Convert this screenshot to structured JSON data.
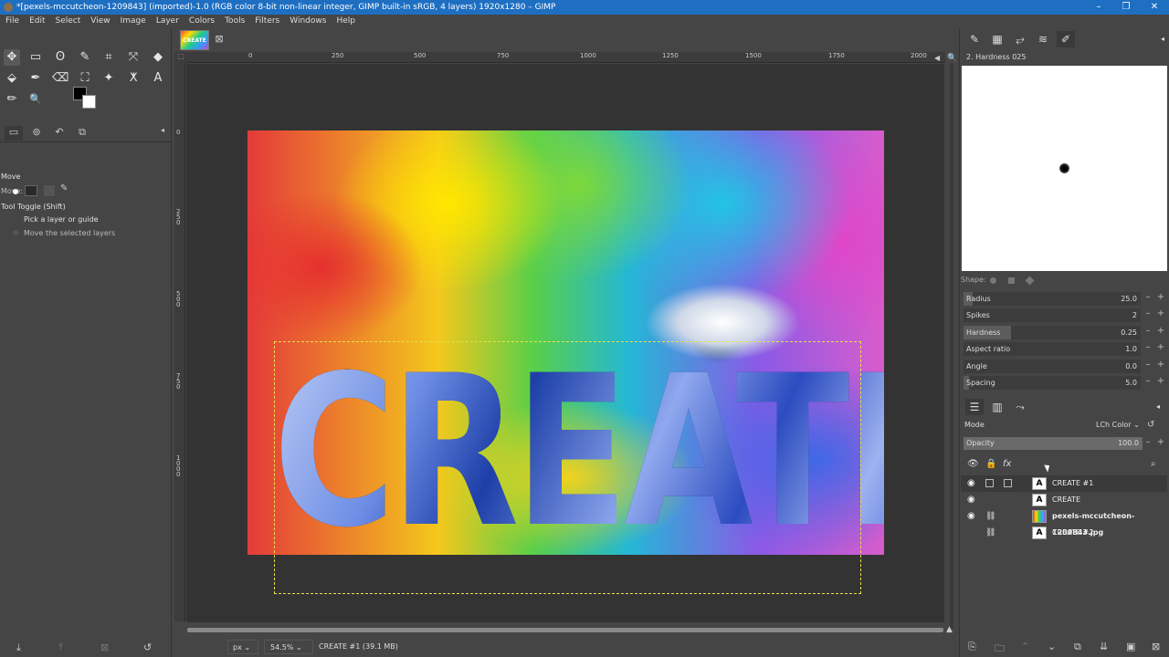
{
  "window": {
    "title": "*[pexels-mccutcheon-1209843] (imported)-1.0 (RGB color 8-bit non-linear integer, GIMP built-in sRGB, 4 layers) 1920x1280 – GIMP",
    "minimize": "–",
    "maximize": "❐",
    "close": "✕"
  },
  "menu": [
    "File",
    "Edit",
    "Select",
    "View",
    "Image",
    "Layer",
    "Colors",
    "Tools",
    "Filters",
    "Windows",
    "Help"
  ],
  "toolbox": {
    "tools_row1": [
      "✥",
      "▭",
      "ʘ",
      "✎",
      "⌗",
      "⤧",
      "◆"
    ],
    "tools_row2": [
      "⬙",
      "✒",
      "⌫",
      "⛶",
      "✦",
      "ⵅ",
      "A"
    ],
    "tools_row3": [
      "✏",
      "🔍"
    ],
    "fg_color": "#000000",
    "bg_color": "#ffffff",
    "options_title": "Move",
    "move_label": "Move:",
    "tool_toggle": "Tool Toggle (Shift)",
    "option1": "Pick a layer or guide",
    "option2": "Move the selected layers"
  },
  "image_tab": {
    "label": "CREATE"
  },
  "ruler": {
    "h_ticks": [
      "0",
      "250",
      "500",
      "750",
      "1000",
      "1250",
      "1500",
      "1750",
      "2000"
    ],
    "v_ticks": [
      "0",
      "2 5 0",
      "5 0 0",
      "7 5 0",
      "1 0 0 0"
    ]
  },
  "canvas": {
    "create_text": "CREATE"
  },
  "statusbar": {
    "unit": "px",
    "zoom": "54.5%",
    "info": "CREATE #1 (39.1 MB)"
  },
  "brush": {
    "title": "2. Hardness 025",
    "shape_label": "Shape:",
    "params": [
      {
        "label": "Radius",
        "value": "25.0",
        "fill": 0.05
      },
      {
        "label": "Spikes",
        "value": "2",
        "fill": 0.0
      },
      {
        "label": "Hardness",
        "value": "0.25",
        "fill": 0.25
      },
      {
        "label": "Aspect ratio",
        "value": "1.0",
        "fill": 0.0
      },
      {
        "label": "Angle",
        "value": "0.0",
        "fill": 0.0
      },
      {
        "label": "Spacing",
        "value": "5.0",
        "fill": 0.03
      }
    ]
  },
  "layers": {
    "mode_label": "Mode",
    "mode_value": "LCh Color",
    "opacity_label": "Opacity",
    "opacity_value": "100.0",
    "items": [
      {
        "name": "CREATE #1",
        "thumb": "A",
        "photo": false,
        "selected": true
      },
      {
        "name": "CREATE",
        "thumb": "A",
        "photo": false,
        "selected": false
      },
      {
        "name": "pexels-mccutcheon-1209843.jpg",
        "thumb": "",
        "photo": true,
        "selected": false
      },
      {
        "name": "CREATE #2",
        "thumb": "A",
        "photo": false,
        "selected": false
      }
    ]
  }
}
